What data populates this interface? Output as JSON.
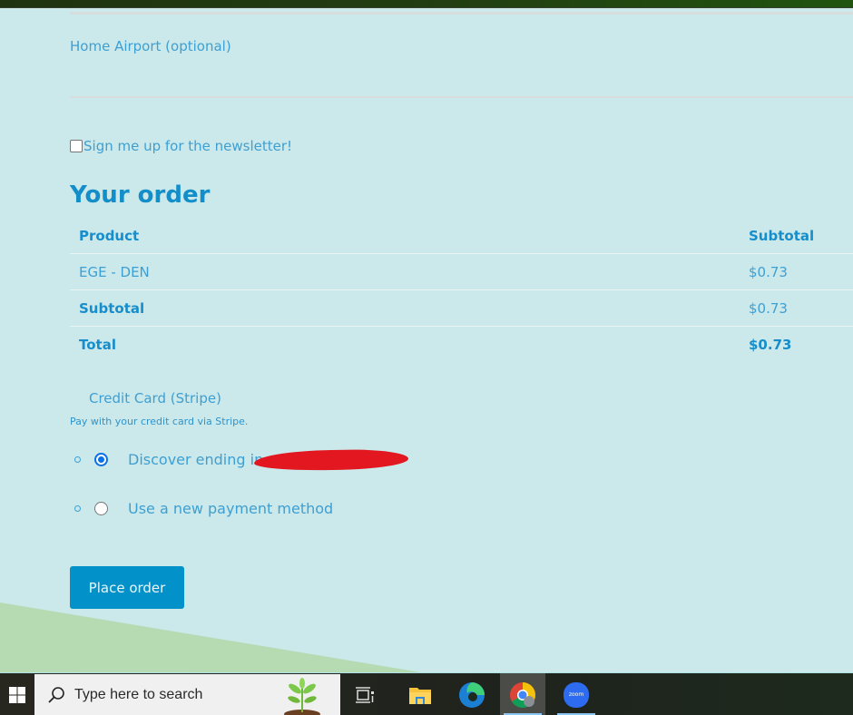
{
  "form": {
    "home_airport_label": "Home Airport (optional)",
    "newsletter_label": "Sign me up for the newsletter!",
    "newsletter_checked": false
  },
  "order": {
    "title": "Your order",
    "columns": [
      "Product",
      "Subtotal"
    ],
    "items": [
      {
        "product": "EGE - DEN",
        "subtotal": "$0.73"
      }
    ],
    "subtotal_label": "Subtotal",
    "subtotal_value": "$0.73",
    "total_label": "Total",
    "total_value": "$0.73"
  },
  "payment": {
    "method_title": "Credit Card (Stripe)",
    "description": "Pay with your credit card via Stripe.",
    "options": [
      {
        "label": "Discover ending in",
        "selected": true,
        "redacted": true
      },
      {
        "label": "Use a new payment method",
        "selected": false
      }
    ],
    "place_order_label": "Place order"
  },
  "taskbar": {
    "search_placeholder": "Type here to search",
    "apps": [
      "task-view",
      "file-explorer",
      "edge",
      "chrome",
      "zoom"
    ],
    "active_app": "chrome",
    "zoom_label": "zoom"
  },
  "colors": {
    "page_bg": "#cbe9eb",
    "accent": "#0291c9",
    "text": "#3e9fd2",
    "heading": "#138ec9",
    "radio_selected": "#0b6fe8"
  }
}
